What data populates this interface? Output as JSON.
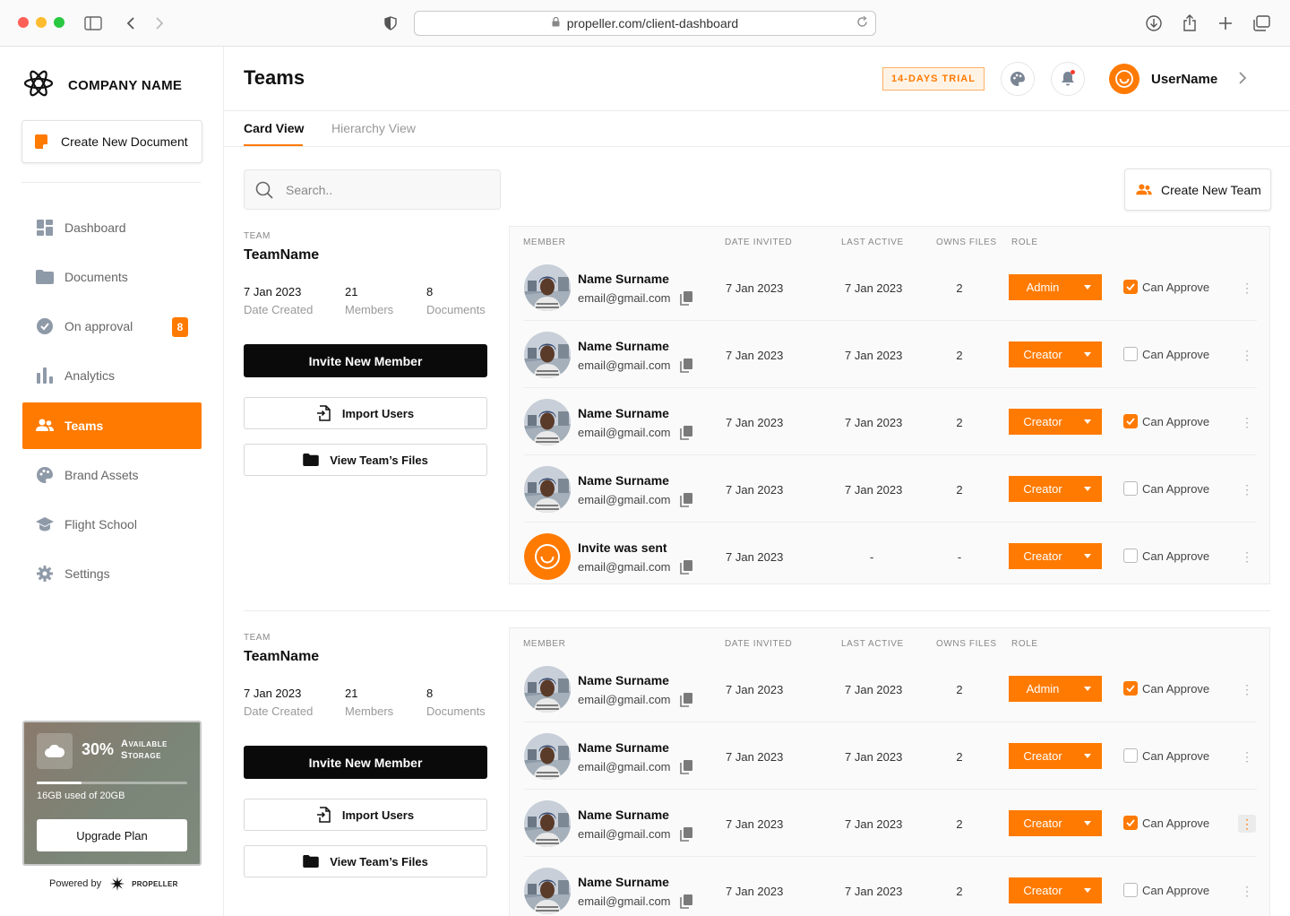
{
  "browser": {
    "url": "propeller.com/client-dashboard"
  },
  "sidebar": {
    "company": "COMPANY NAME",
    "create_doc": "Create New Document",
    "items": [
      {
        "label": "Dashboard",
        "icon": "dashboard-icon"
      },
      {
        "label": "Documents",
        "icon": "folder-icon"
      },
      {
        "label": "On approval",
        "icon": "check-circle-icon",
        "badge": "8"
      },
      {
        "label": "Analytics",
        "icon": "bar-chart-icon"
      },
      {
        "label": "Teams",
        "icon": "people-icon",
        "active": true
      },
      {
        "label": "Brand Assets",
        "icon": "palette-icon"
      },
      {
        "label": "Flight School",
        "icon": "graduation-cap-icon"
      },
      {
        "label": "Settings",
        "icon": "gear-icon"
      }
    ],
    "storage": {
      "percent": "30%",
      "available": "Available Storage",
      "used": "16GB used of 20GB",
      "used_fraction": 0.3,
      "upgrade": "Upgrade Plan"
    },
    "powered_by": "Powered by",
    "powered_brand": "PROPELLER"
  },
  "header": {
    "title": "Teams",
    "trial": "14-DAYS TRIAL",
    "username": "UserName"
  },
  "tabs": {
    "card": "Card View",
    "hierarchy": "Hierarchy View"
  },
  "search": {
    "placeholder": "Search.."
  },
  "create_team": "Create New Team",
  "colors": {
    "accent": "#ff7a00",
    "dark": "#0a0a0a"
  },
  "team_labels": {
    "team": "TEAM",
    "date_created": "Date Created",
    "members": "Members",
    "documents": "Documents",
    "invite": "Invite New Member",
    "import": "Import Users",
    "view_files": "View Team’s Files"
  },
  "table_headers": {
    "member": "MEMBER",
    "date_invited": "DATE INVITED",
    "last_active": "LAST ACTIVE",
    "owns_files": "OWNS FILES",
    "role": "ROLE"
  },
  "teams": [
    {
      "name": "TeamName",
      "date": "7 Jan 2023",
      "members": "21",
      "documents": "8",
      "rows": [
        {
          "name": "Name Surname",
          "email": "email@gmail.com",
          "invited": "7 Jan 2023",
          "active": "7 Jan 2023",
          "files": "2",
          "role": "Admin",
          "approve": "Can Approve",
          "checked": true,
          "avatar": "photo"
        },
        {
          "name": "Name Surname",
          "email": "email@gmail.com",
          "invited": "7 Jan 2023",
          "active": "7 Jan 2023",
          "files": "2",
          "role": "Creator",
          "approve": "Can Approve",
          "checked": false,
          "avatar": "photo"
        },
        {
          "name": "Name Surname",
          "email": "email@gmail.com",
          "invited": "7 Jan 2023",
          "active": "7 Jan 2023",
          "files": "2",
          "role": "Creator",
          "approve": "Can Approve",
          "checked": true,
          "avatar": "photo"
        },
        {
          "name": "Name Surname",
          "email": "email@gmail.com",
          "invited": "7 Jan 2023",
          "active": "7 Jan 2023",
          "files": "2",
          "role": "Creator",
          "approve": "Can Approve",
          "checked": false,
          "avatar": "photo"
        },
        {
          "name": "Invite was sent",
          "email": "email@gmail.com",
          "invited": "7 Jan 2023",
          "active": "-",
          "files": "-",
          "role": "Creator",
          "approve": "Can Approve",
          "checked": false,
          "avatar": "pending"
        }
      ]
    },
    {
      "name": "TeamName",
      "date": "7 Jan 2023",
      "members": "21",
      "documents": "8",
      "rows": [
        {
          "name": "Name Surname",
          "email": "email@gmail.com",
          "invited": "7 Jan 2023",
          "active": "7 Jan 2023",
          "files": "2",
          "role": "Admin",
          "approve": "Can Approve",
          "checked": true,
          "avatar": "photo"
        },
        {
          "name": "Name Surname",
          "email": "email@gmail.com",
          "invited": "7 Jan 2023",
          "active": "7 Jan 2023",
          "files": "2",
          "role": "Creator",
          "approve": "Can Approve",
          "checked": false,
          "avatar": "photo"
        },
        {
          "name": "Name Surname",
          "email": "email@gmail.com",
          "invited": "7 Jan 2023",
          "active": "7 Jan 2023",
          "files": "2",
          "role": "Creator",
          "approve": "Can Approve",
          "checked": true,
          "avatar": "photo",
          "menu_active": true
        },
        {
          "name": "Name Surname",
          "email": "email@gmail.com",
          "invited": "7 Jan 2023",
          "active": "7 Jan 2023",
          "files": "2",
          "role": "Creator",
          "approve": "Can Approve",
          "checked": false,
          "avatar": "photo"
        }
      ]
    }
  ]
}
